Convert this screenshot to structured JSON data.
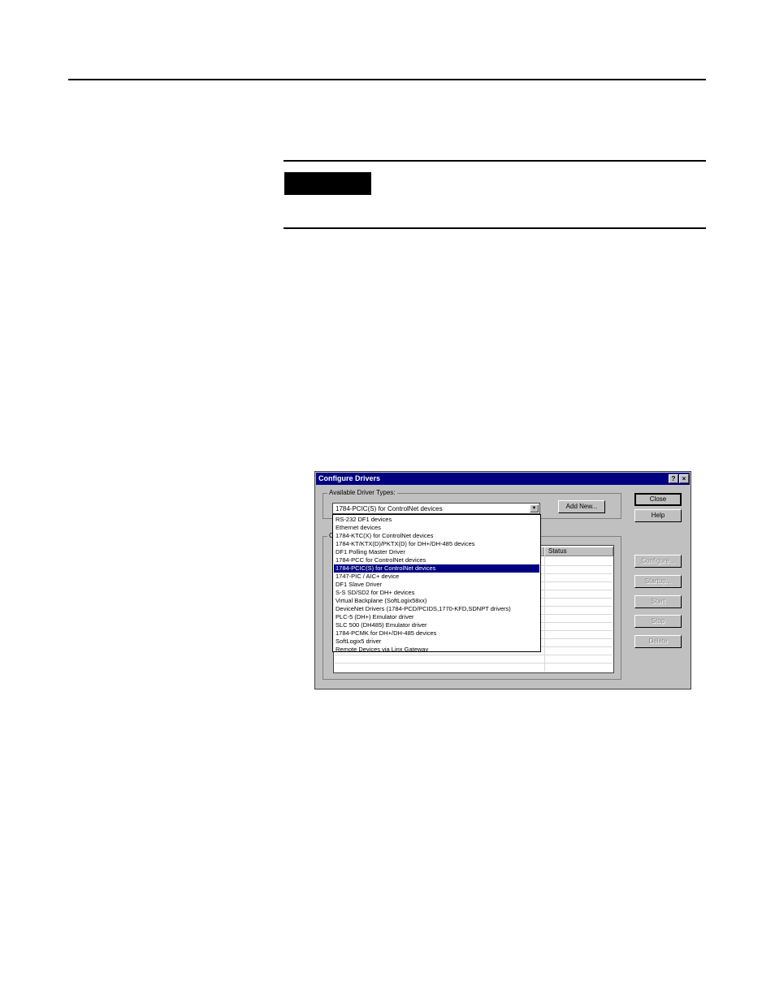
{
  "dialog": {
    "title": "Configure Drivers",
    "help_button": "?",
    "close_x": "×",
    "available_group_label": "Available Driver Types:",
    "selected_driver": "1784-PCIC(S) for ControlNet devices",
    "add_new_label": "Add New...",
    "configured_group_label": "C",
    "table_headers": [
      "",
      "Status"
    ],
    "buttons": {
      "close": "Close",
      "help": "Help",
      "configure": "Configure...",
      "startup": "Startup...",
      "start": "Start",
      "stop": "Stop",
      "delete": "Delete"
    },
    "driver_options": [
      "RS-232 DF1 devices",
      "Ethernet devices",
      "1784-KTC(X) for ControlNet devices",
      "1784-KT/KTX(D)/PKTX(D) for DH+/DH-485 devices",
      "DF1 Polling Master Driver",
      "1784-PCC for ControlNet devices",
      "1784-PCIC(S) for ControlNet devices",
      "1747-PIC / AIC+ device",
      "DF1 Slave Driver",
      "S-S SD/SD2 for DH+ devices",
      "Virtual Backplane (SoftLogix58xx)",
      "DeviceNet Drivers (1784-PCD/PCIDS,1770-KFD,SDNPT drivers)",
      "PLC-5 (DH+) Emulator driver",
      "SLC 500 (DH485) Emulator driver",
      "1784-PCMK for DH+/DH-485 devices",
      "SoftLogix5 driver",
      "Remote Devices via Linx Gateway"
    ],
    "selected_index": 6
  },
  "colors": {
    "title_bar": "#000080",
    "dialog_face": "#c0c0c0",
    "selection": "#000080"
  }
}
